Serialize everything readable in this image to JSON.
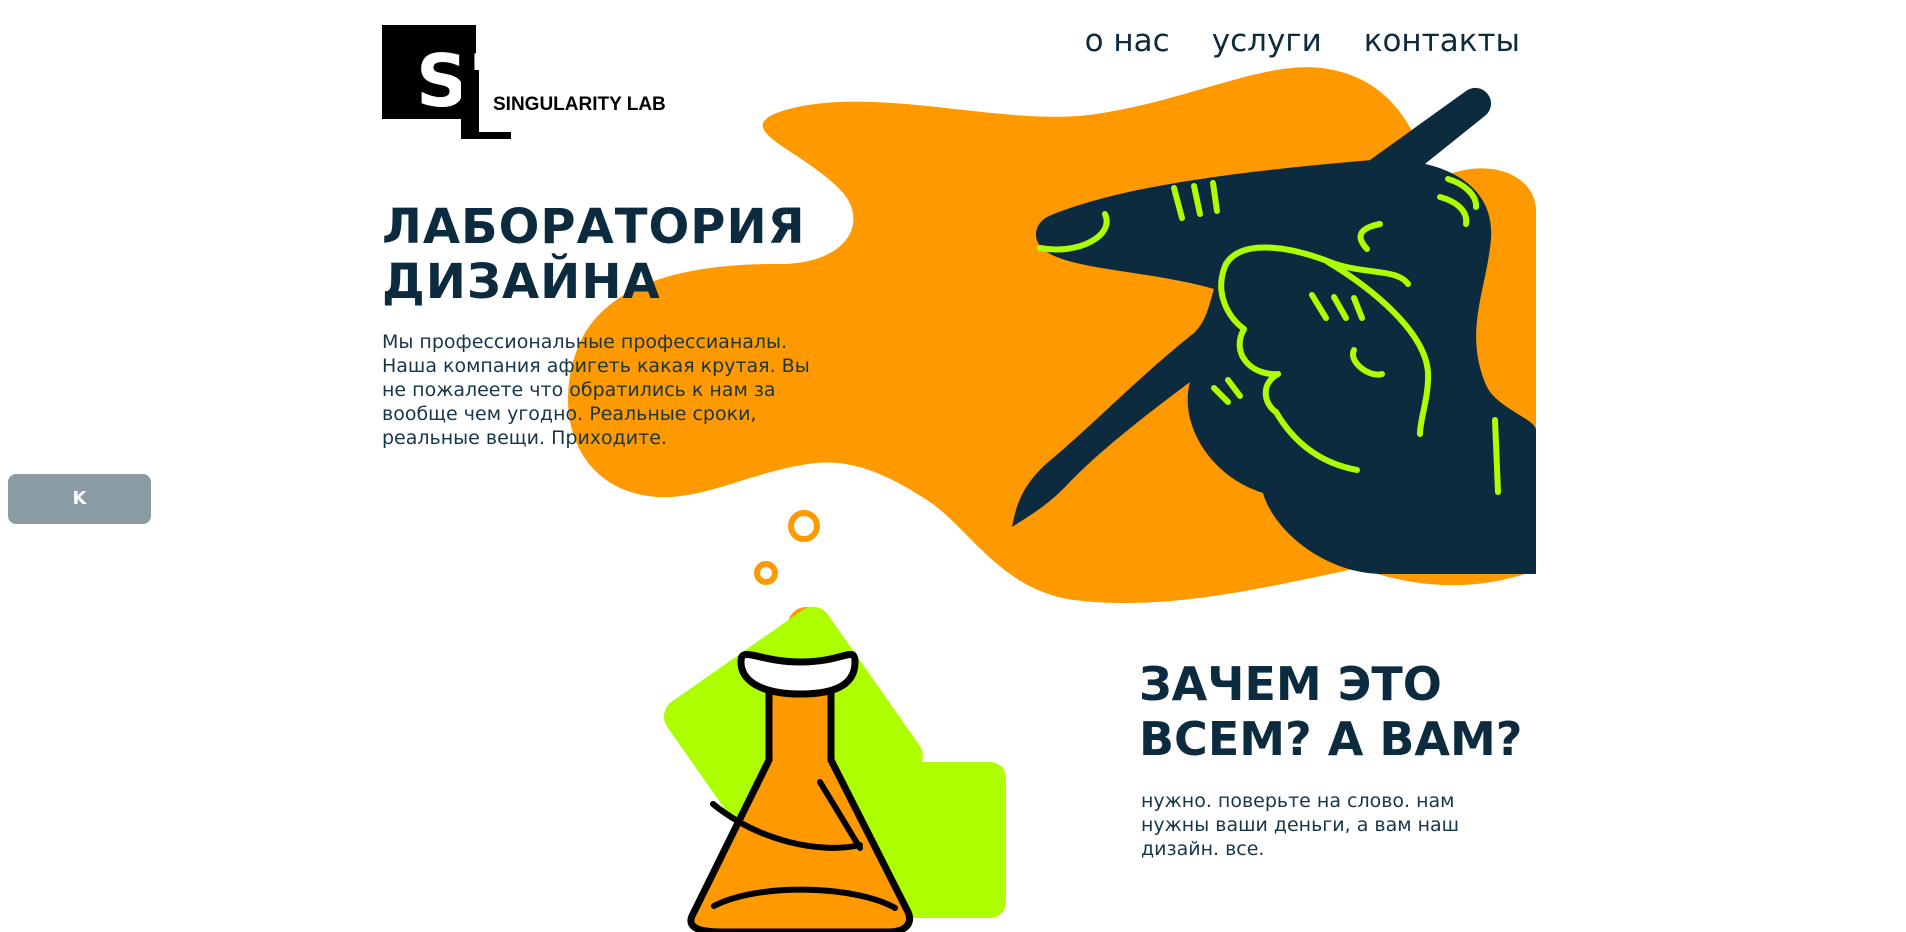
{
  "brand": {
    "name": "SINGULARITY LAB",
    "mark": "SL"
  },
  "nav": {
    "items": [
      "о нас",
      "услуги",
      "контакты"
    ]
  },
  "hero": {
    "title": "ЛАБОРАТОРИЯ ДИЗАЙНА",
    "text": "Мы профессиональные профессианалы. Наша компания афигеть какая крутая. Вы не пожалеете что обратились к нам за вообще чем угодно. Реальные сроки, реальные вещи. Приходите."
  },
  "side_widget": {
    "label": "K"
  },
  "why": {
    "title": "ЗАЧЕМ ЭТО ВСЕМ? А ВАМ?",
    "text": "нужно. поверьте на слово. нам нужны ваши деньги, а вам наш дизайн. все."
  },
  "colors": {
    "navy": "#0c2b3e",
    "orange": "#ff9900",
    "lime": "#adff00",
    "gray": "#8b9ba4"
  },
  "icons": {
    "hero_illustration": "pointing-hand-illustration",
    "section_illustration": "flask-illustration"
  }
}
